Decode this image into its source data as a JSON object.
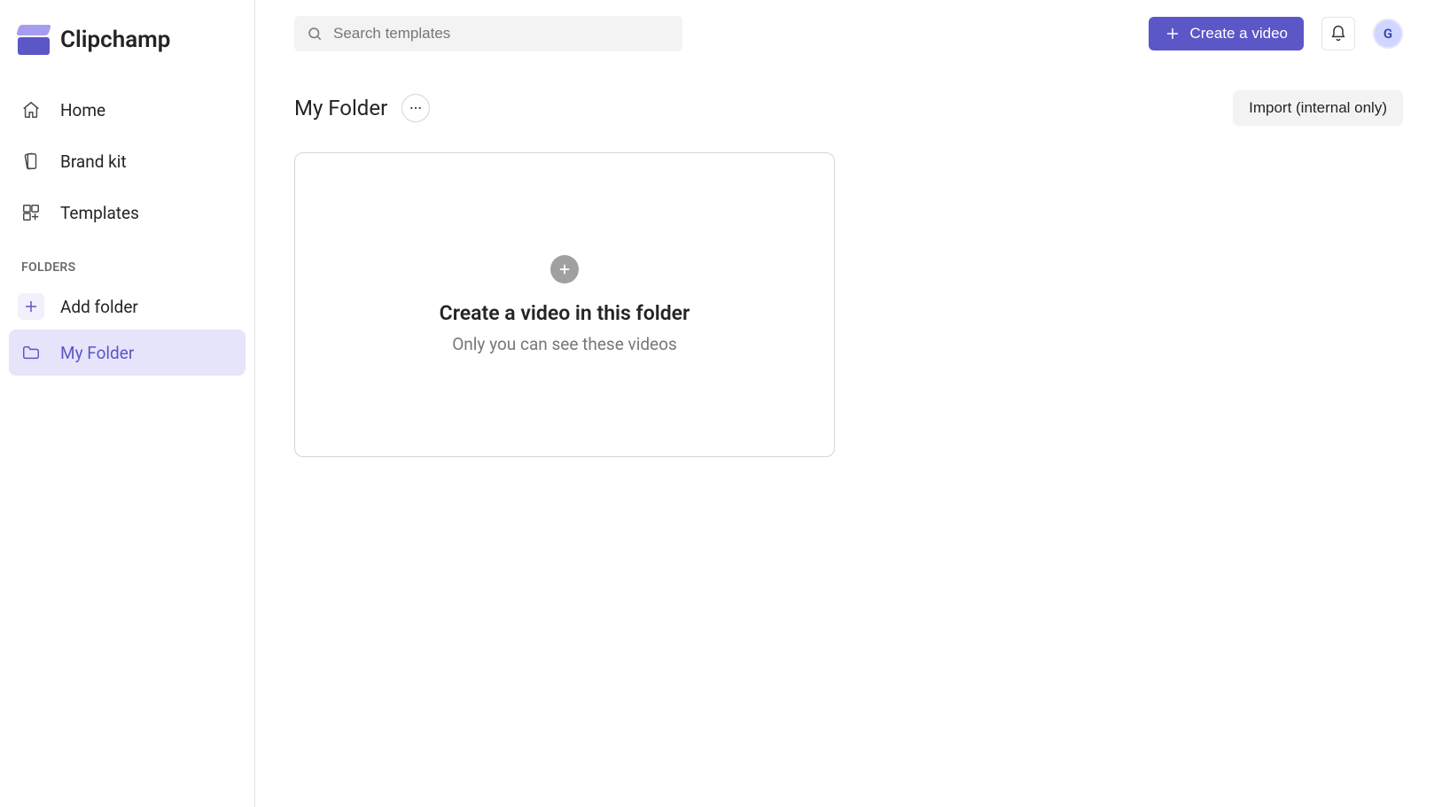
{
  "brand": {
    "name": "Clipchamp"
  },
  "sidebar": {
    "nav": [
      {
        "label": "Home"
      },
      {
        "label": "Brand kit"
      },
      {
        "label": "Templates"
      }
    ],
    "folders_heading": "FOLDERS",
    "add_folder_label": "Add folder",
    "folders": [
      {
        "label": "My Folder",
        "active": true
      }
    ]
  },
  "header": {
    "search_placeholder": "Search templates",
    "create_button": "Create a video",
    "avatar_initial": "G"
  },
  "page": {
    "title": "My Folder",
    "import_button": "Import (internal only)"
  },
  "empty_card": {
    "title": "Create a video in this folder",
    "subtitle": "Only you can see these videos"
  }
}
